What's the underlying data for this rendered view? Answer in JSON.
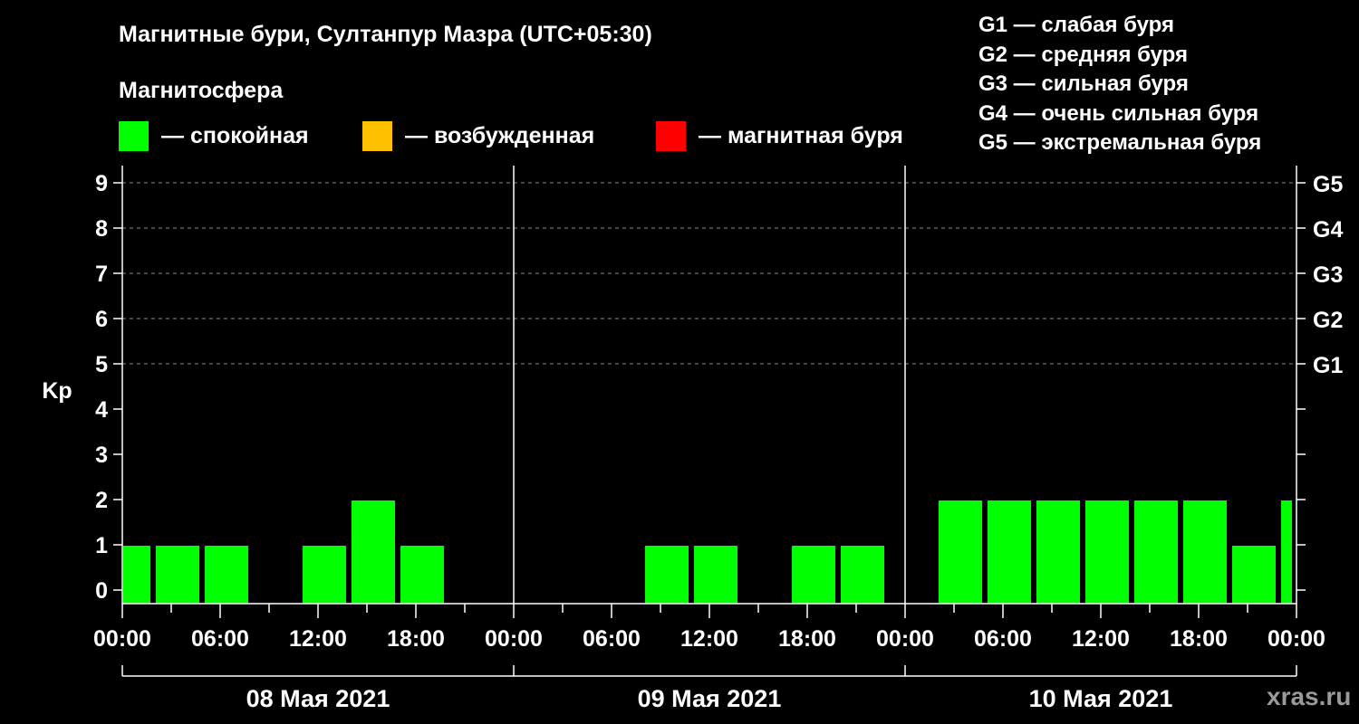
{
  "title": "Магнитные бури, Султанпур Мазра (UTC+05:30)",
  "magnetosphere": {
    "heading": "Магнитосфера",
    "legend": [
      {
        "label": "— спокойная",
        "color": "#00ff00"
      },
      {
        "label": "— возбужденная",
        "color": "#ffc000"
      },
      {
        "label": "— магнитная буря",
        "color": "#ff0000"
      }
    ]
  },
  "g_scale_legend": [
    "G1 — слабая буря",
    "G2 — средняя буря",
    "G3 — сильная буря",
    "G4 — очень сильная буря",
    "G5 — экстремальная буря"
  ],
  "watermark": "xras.ru",
  "chart_data": {
    "type": "bar",
    "ylabel": "Kp",
    "ylim": [
      0,
      9
    ],
    "yticks": [
      "0",
      "1",
      "2",
      "3",
      "4",
      "5",
      "6",
      "7",
      "8",
      "9"
    ],
    "g_levels": [
      {
        "label": "G1",
        "kp": 5
      },
      {
        "label": "G2",
        "kp": 6
      },
      {
        "label": "G3",
        "kp": 7
      },
      {
        "label": "G4",
        "kp": 8
      },
      {
        "label": "G5",
        "kp": 9
      }
    ],
    "x_range_hours": [
      0,
      72
    ],
    "xtick_labels": [
      "00:00",
      "06:00",
      "12:00",
      "18:00",
      "00:00",
      "06:00",
      "12:00",
      "18:00",
      "00:00",
      "06:00",
      "12:00",
      "18:00",
      "00:00"
    ],
    "days": [
      "08 Мая 2021",
      "09 Мая 2021",
      "10 Мая 2021"
    ],
    "grid": "dashed horizontal lines at Kp 5–9",
    "series": [
      {
        "color": "#00ff00",
        "bars": [
          {
            "start_h": 0,
            "end_h": 2,
            "kp": 1
          },
          {
            "start_h": 2,
            "end_h": 5,
            "kp": 1
          },
          {
            "start_h": 5,
            "end_h": 8,
            "kp": 1
          },
          {
            "start_h": 8,
            "end_h": 11,
            "kp": 0
          },
          {
            "start_h": 11,
            "end_h": 14,
            "kp": 1
          },
          {
            "start_h": 14,
            "end_h": 17,
            "kp": 2
          },
          {
            "start_h": 17,
            "end_h": 20,
            "kp": 1
          },
          {
            "start_h": 20,
            "end_h": 23,
            "kp": 0
          },
          {
            "start_h": 23,
            "end_h": 26,
            "kp": 0
          },
          {
            "start_h": 26,
            "end_h": 29,
            "kp": 0
          },
          {
            "start_h": 29,
            "end_h": 32,
            "kp": 0
          },
          {
            "start_h": 32,
            "end_h": 35,
            "kp": 1
          },
          {
            "start_h": 35,
            "end_h": 38,
            "kp": 1
          },
          {
            "start_h": 38,
            "end_h": 41,
            "kp": 0
          },
          {
            "start_h": 41,
            "end_h": 44,
            "kp": 1
          },
          {
            "start_h": 44,
            "end_h": 47,
            "kp": 1
          },
          {
            "start_h": 47,
            "end_h": 50,
            "kp": 0
          },
          {
            "start_h": 50,
            "end_h": 53,
            "kp": 2
          },
          {
            "start_h": 53,
            "end_h": 56,
            "kp": 2
          },
          {
            "start_h": 56,
            "end_h": 59,
            "kp": 2
          },
          {
            "start_h": 59,
            "end_h": 62,
            "kp": 2
          },
          {
            "start_h": 62,
            "end_h": 65,
            "kp": 2
          },
          {
            "start_h": 65,
            "end_h": 68,
            "kp": 2
          },
          {
            "start_h": 68,
            "end_h": 71,
            "kp": 1
          },
          {
            "start_h": 71,
            "end_h": 72,
            "kp": 2
          }
        ]
      }
    ]
  }
}
